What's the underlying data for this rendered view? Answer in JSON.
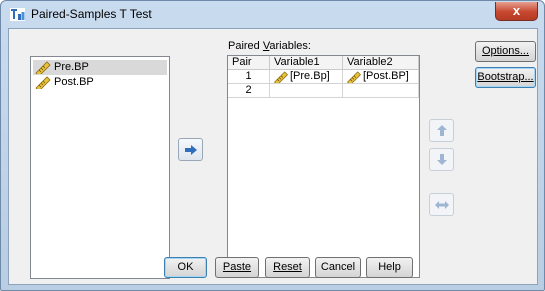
{
  "window": {
    "title": "Paired-Samples T Test",
    "close_label": "x"
  },
  "source_list": {
    "items": [
      {
        "label": "Pre.BP",
        "selected": true
      },
      {
        "label": "Post.BP",
        "selected": false
      }
    ]
  },
  "paired": {
    "label": "Paired Variables:",
    "label_prefix": "Paired ",
    "label_underlined": "V",
    "label_suffix": "ariables:",
    "headers": [
      "Pair",
      "Variable1",
      "Variable2"
    ],
    "rows": [
      {
        "pair": "1",
        "var1": "[Pre.Bp]",
        "var2": "[Post.BP]"
      },
      {
        "pair": "2",
        "var1": "",
        "var2": ""
      }
    ]
  },
  "side_buttons": {
    "options": "Options...",
    "bootstrap": "Bootstrap..."
  },
  "bottom_buttons": {
    "ok": "OK",
    "paste": "Paste",
    "reset": "Reset",
    "cancel": "Cancel",
    "help": "Help"
  },
  "icons": {
    "app": "t-test-icon",
    "variable": "ruler-pencil-scale-icon",
    "move_right": "arrow-right-icon",
    "move_up": "arrow-up-icon",
    "move_down": "arrow-down-icon",
    "swap": "swap-horizontal-icon"
  },
  "colors": {
    "accent_blue": "#2f6ebd",
    "selection_gray": "#d9d9d9",
    "close_red": "#c8472e"
  }
}
